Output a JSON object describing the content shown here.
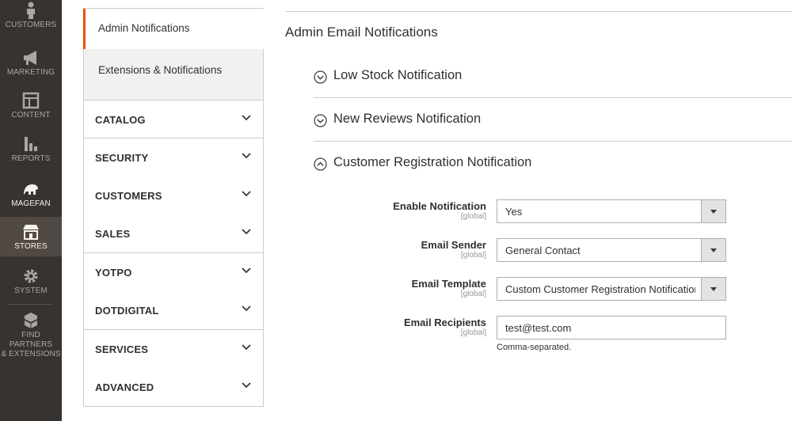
{
  "admin_menu": {
    "items": [
      {
        "label": "CUSTOMERS",
        "icon": "customers-icon"
      },
      {
        "label": "MARKETING",
        "icon": "megaphone-icon"
      },
      {
        "label": "CONTENT",
        "icon": "content-icon"
      },
      {
        "label": "REPORTS",
        "icon": "bar-chart-icon"
      },
      {
        "label": "MAGEFAN",
        "icon": "magefan-icon"
      },
      {
        "label": "STORES",
        "icon": "store-icon"
      },
      {
        "label": "SYSTEM",
        "icon": "gear-icon"
      },
      {
        "label": "FIND PARTNERS\n& EXTENSIONS",
        "icon": "cubes-icon"
      }
    ],
    "active": "STORES",
    "colors": {
      "bg": "#373330",
      "active_bg": "#514943",
      "accent": "#eb5202"
    }
  },
  "config_tabs": {
    "current_subitem": "Admin Notifications",
    "other_subitem": "Extensions & Notifications",
    "sections": [
      {
        "label": "CATALOG"
      },
      {
        "label": "SECURITY"
      },
      {
        "label": "CUSTOMERS"
      },
      {
        "label": "SALES"
      },
      {
        "label": "YOTPO"
      },
      {
        "label": "DOTDIGITAL"
      },
      {
        "label": "SERVICES"
      },
      {
        "label": "ADVANCED"
      }
    ]
  },
  "main": {
    "section_title": "Admin Email Notifications",
    "groups": [
      {
        "title": "Low Stock Notification",
        "state": "collapsed"
      },
      {
        "title": "New Reviews Notification",
        "state": "collapsed"
      },
      {
        "title": "Customer Registration Notification",
        "state": "expanded"
      }
    ],
    "fields": {
      "enable": {
        "label": "Enable Notification",
        "scope": "[global]",
        "value": "Yes"
      },
      "sender": {
        "label": "Email Sender",
        "scope": "[global]",
        "value": "General Contact"
      },
      "template": {
        "label": "Email Template",
        "scope": "[global]",
        "value": "Custom Customer Registration Notification"
      },
      "recipients": {
        "label": "Email Recipients",
        "scope": "[global]",
        "value": "test@test.com",
        "note": "Comma-separated."
      }
    }
  }
}
